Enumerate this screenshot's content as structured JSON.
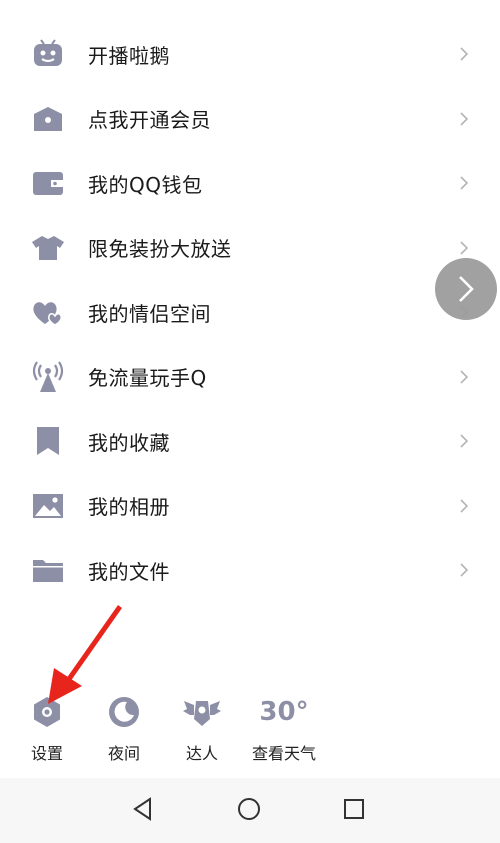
{
  "menu": {
    "items": [
      {
        "label": "开播啦鹅",
        "icon": "tv-robot-icon"
      },
      {
        "label": "点我开通会员",
        "icon": "crown-icon"
      },
      {
        "label": "我的QQ钱包",
        "icon": "wallet-icon"
      },
      {
        "label": "限免装扮大放送",
        "icon": "shirt-icon"
      },
      {
        "label": "我的情侣空间",
        "icon": "hearts-icon"
      },
      {
        "label": "免流量玩手Q",
        "icon": "signal-tower-icon"
      },
      {
        "label": "我的收藏",
        "icon": "bookmark-icon"
      },
      {
        "label": "我的相册",
        "icon": "photo-icon"
      },
      {
        "label": "我的文件",
        "icon": "folder-icon"
      }
    ]
  },
  "bottom": {
    "settings": "设置",
    "night": "夜间",
    "talent": "达人",
    "weather_temp": "30°",
    "weather": "查看天气"
  },
  "colors": {
    "icon": "#8d8fa6",
    "chevron": "#b5b5b5",
    "arrow": "#e8251c"
  }
}
